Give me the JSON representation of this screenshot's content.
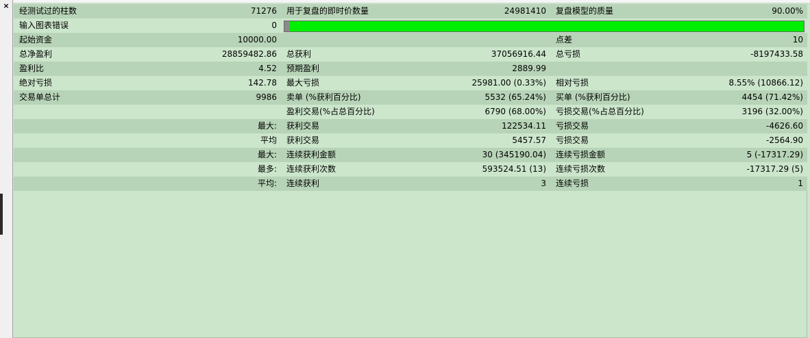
{
  "window": {
    "close_glyph": "×"
  },
  "report": {
    "rows": [
      [
        "经测试过的柱数",
        "71276",
        "用于复盘的即时价数量",
        "24981410",
        "复盘模型的质量",
        "90.00%"
      ],
      [
        "输入图表错误",
        "0",
        "",
        "",
        "",
        ""
      ],
      [
        "起始资金",
        "10000.00",
        "",
        "",
        "点差",
        "10"
      ],
      [
        "总净盈利",
        "28859482.86",
        "总获利",
        "37056916.44",
        "总亏损",
        "-8197433.58"
      ],
      [
        "盈利比",
        "4.52",
        "预期盈利",
        "2889.99",
        "",
        ""
      ],
      [
        "绝对亏损",
        "142.78",
        "最大亏损",
        "25981.00 (0.33%)",
        "相对亏损",
        "8.55% (10866.12)"
      ],
      [
        "交易单总计",
        "9986",
        "卖单 (%获利百分比)",
        "5532 (65.24%)",
        "买单 (%获利百分比)",
        "4454 (71.42%)"
      ],
      [
        "",
        "",
        "盈利交易(%占总百分比)",
        "6790 (68.00%)",
        "亏损交易(%占总百分比)",
        "3196 (32.00%)"
      ],
      [
        "",
        "最大:",
        "获利交易",
        "122534.11",
        "亏损交易",
        "-4626.60"
      ],
      [
        "",
        "平均",
        "获利交易",
        "5457.57",
        "亏损交易",
        "-2564.90"
      ],
      [
        "",
        "最大:",
        "连续获利金额",
        "30 (345190.04)",
        "连续亏损金额",
        "5 (-17317.29)"
      ],
      [
        "",
        "最多:",
        "连续获利次数",
        "593524.51 (13)",
        "连续亏损次数",
        "-17317.29 (5)"
      ],
      [
        "",
        "平均:",
        "连续获利",
        "3",
        "连续亏损",
        "1"
      ]
    ],
    "modeling_quality_fill": 0.99
  },
  "colors": {
    "background": "#cce6cc",
    "row_alt": "#b8d4b8",
    "quality_bar": "#00ee00",
    "quality_bar_error": "#8a8a8a"
  }
}
